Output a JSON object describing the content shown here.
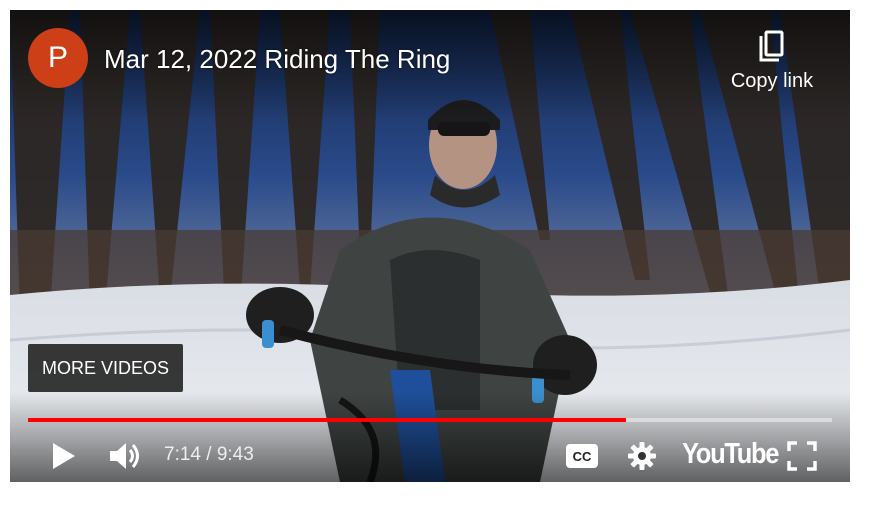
{
  "video": {
    "title": "Mar 12, 2022 Riding The Ring",
    "channel_initial": "P",
    "channel_color": "#cc3f17"
  },
  "overlay": {
    "copy_link_label": "Copy link",
    "more_videos_label": "MORE VIDEOS"
  },
  "player": {
    "current_time": "7:14",
    "duration": "9:43",
    "time_display": "7:14 / 9:43",
    "progress_fraction": 0.744,
    "progress_color": "#ff0000",
    "logo_text": "YouTube"
  },
  "icons": {
    "play": "play-icon",
    "volume": "volume-icon",
    "captions": "closed-captions-icon",
    "settings": "gear-icon",
    "fullscreen": "fullscreen-icon",
    "copy": "copy-icon"
  }
}
